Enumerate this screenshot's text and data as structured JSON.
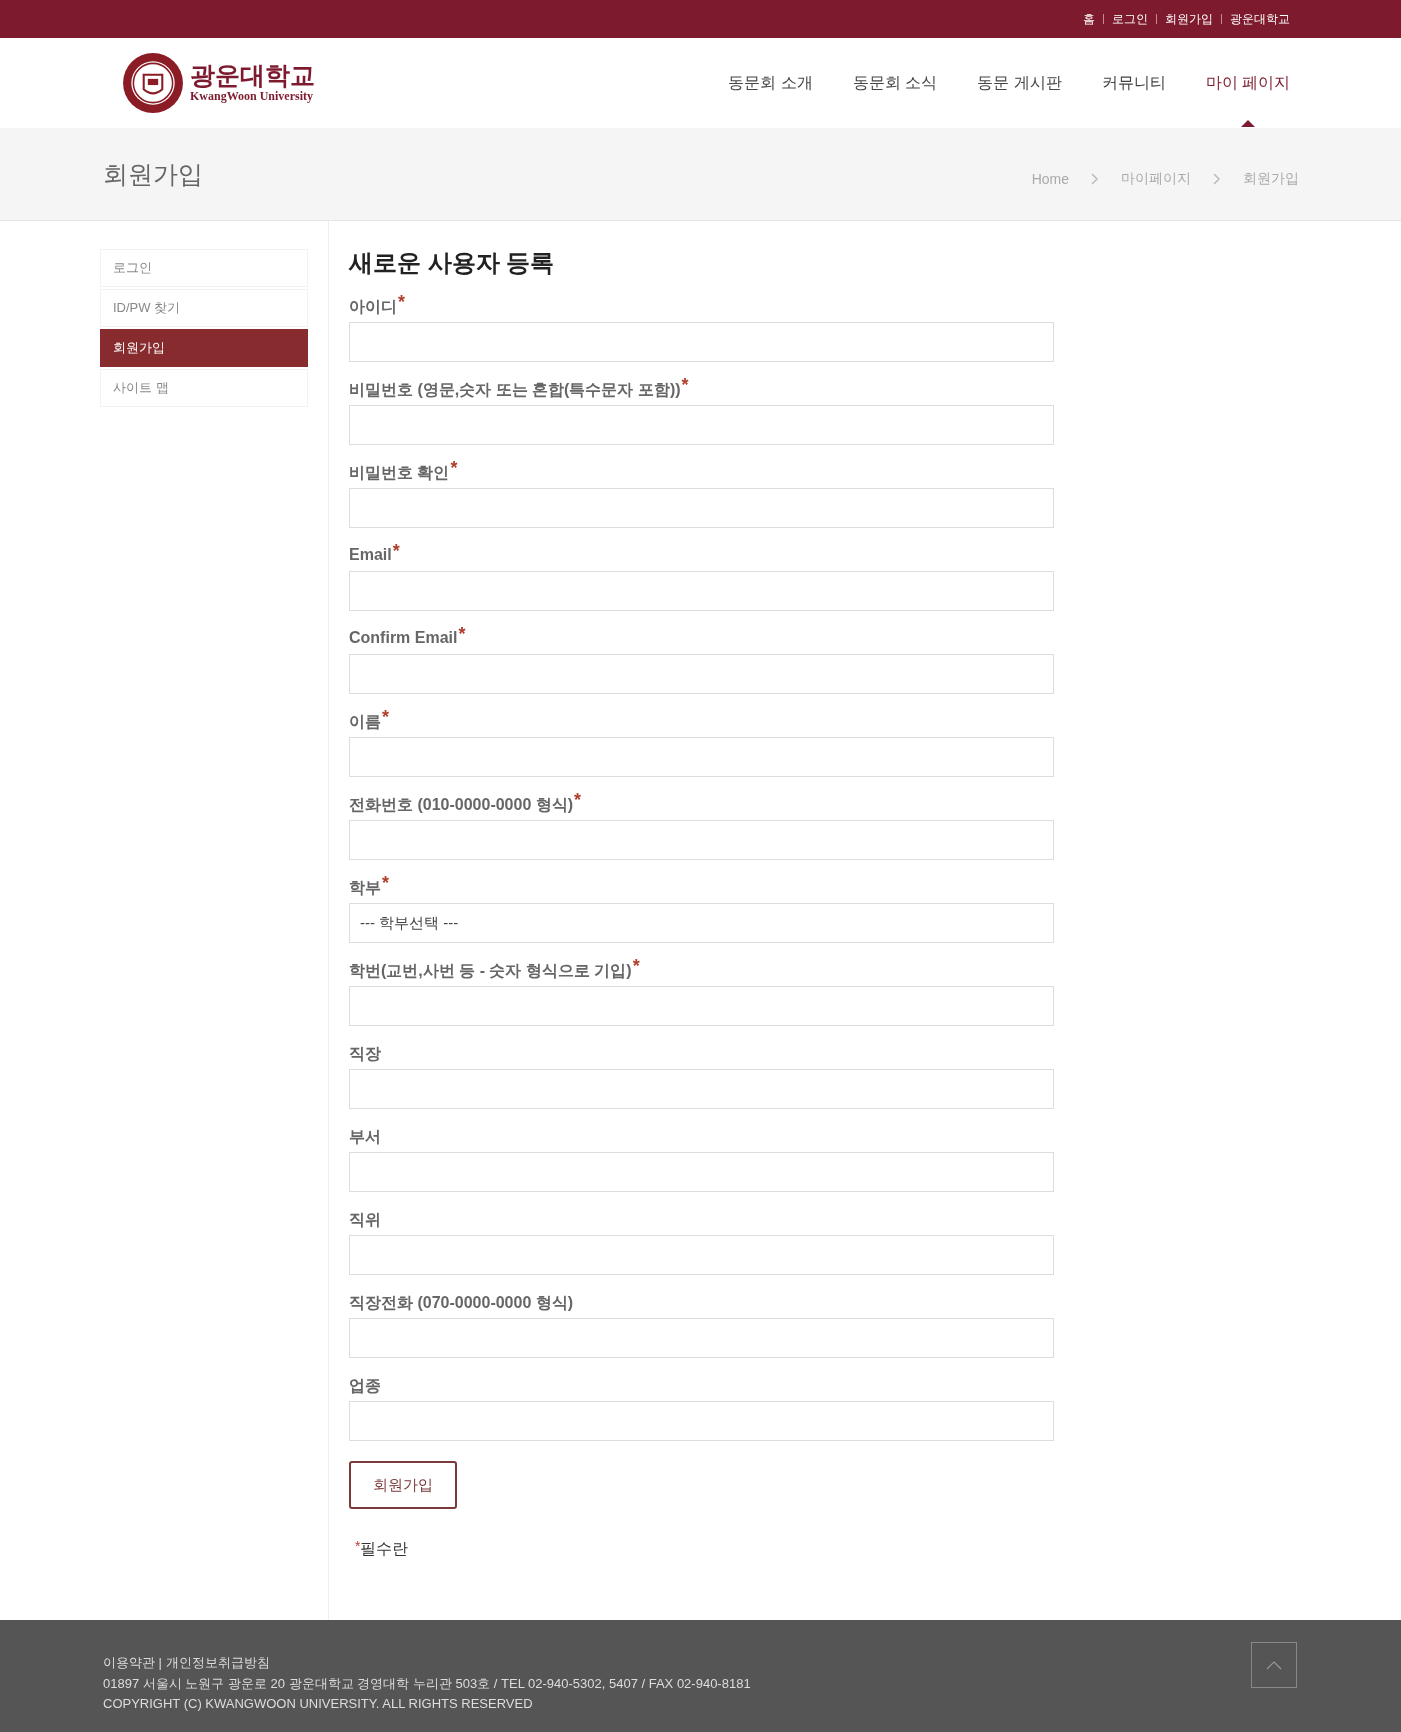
{
  "top_links": [
    "홈",
    "로그인",
    "회원가입",
    "광운대학교"
  ],
  "logo": {
    "name": "광운대학교",
    "subtitle": "KwangWoon University"
  },
  "nav": [
    {
      "label": "동문회 소개",
      "selected": false
    },
    {
      "label": "동문회 소식",
      "selected": false
    },
    {
      "label": "동문 게시판",
      "selected": false
    },
    {
      "label": "커뮤니티",
      "selected": false
    },
    {
      "label": "마이 페이지",
      "selected": true
    }
  ],
  "page_title": "회원가입",
  "breadcrumb": [
    "Home",
    "마이페이지",
    "회원가입"
  ],
  "sidebar": {
    "items": [
      {
        "label": "로그인",
        "selected": false
      },
      {
        "label": "ID/PW 찾기",
        "selected": false
      },
      {
        "label": "회원가입",
        "selected": true
      },
      {
        "label": "사이트 맵",
        "selected": false
      }
    ]
  },
  "form": {
    "title": "새로운 사용자 등록",
    "required_mark": "*",
    "fields": [
      {
        "label": "아이디",
        "required": true,
        "kind": "text"
      },
      {
        "label": "비밀번호 (영문,숫자 또는 혼합(특수문자 포함))",
        "required": true,
        "kind": "text"
      },
      {
        "label": "비밀번호 확인",
        "required": true,
        "kind": "text"
      },
      {
        "label": "Email",
        "required": true,
        "kind": "text"
      },
      {
        "label": "Confirm Email",
        "required": true,
        "kind": "text"
      },
      {
        "label": "이름",
        "required": true,
        "kind": "text"
      },
      {
        "label": "전화번호 (010-0000-0000 형식)",
        "required": true,
        "kind": "text"
      },
      {
        "label": "학부",
        "required": true,
        "kind": "select",
        "value": "--- 학부선택 ---"
      },
      {
        "label": "학번(교번,사번 등 - 숫자 형식으로 기입)",
        "required": true,
        "kind": "text"
      },
      {
        "label": "직장",
        "required": false,
        "kind": "text"
      },
      {
        "label": "부서",
        "required": false,
        "kind": "text"
      },
      {
        "label": "직위",
        "required": false,
        "kind": "text"
      },
      {
        "label": "직장전화 (070-0000-0000 형식)",
        "required": false,
        "kind": "text"
      },
      {
        "label": "업종",
        "required": false,
        "kind": "text"
      }
    ],
    "submit": "회원가입",
    "note": "필수란"
  },
  "footer": {
    "links": "이용약관 | 개인정보취급방침",
    "address": "01897 서울시 노원구 광운로 20 광운대학교 경영대학 누리관 503호 / TEL 02-940-5302, 5407 / FAX 02-940-8181",
    "copyright": "COPYRIGHT (C) KWANGWOON UNIVERSITY. ALL RIGHTS RESERVED"
  }
}
